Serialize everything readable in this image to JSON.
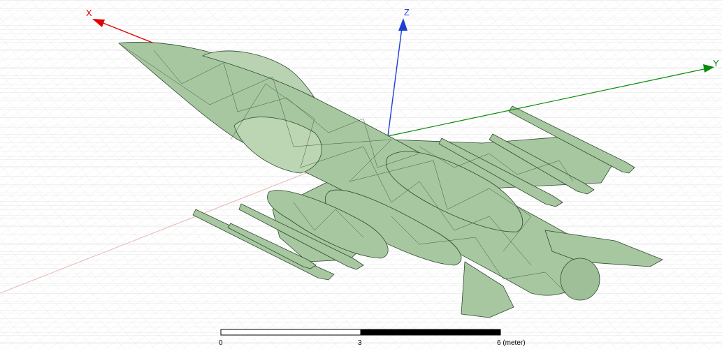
{
  "axes": {
    "x": {
      "label": "X",
      "color": "#e00000"
    },
    "y": {
      "label": "Y",
      "color": "#0a8a0a"
    },
    "z": {
      "label": "Z",
      "color": "#1d3fd6"
    }
  },
  "model": {
    "fill": "#a7c7a0",
    "edge": "#2f4a2f"
  },
  "scale_bar": {
    "tick_0": "0",
    "tick_1": "3",
    "tick_2": "6 (meter)"
  }
}
